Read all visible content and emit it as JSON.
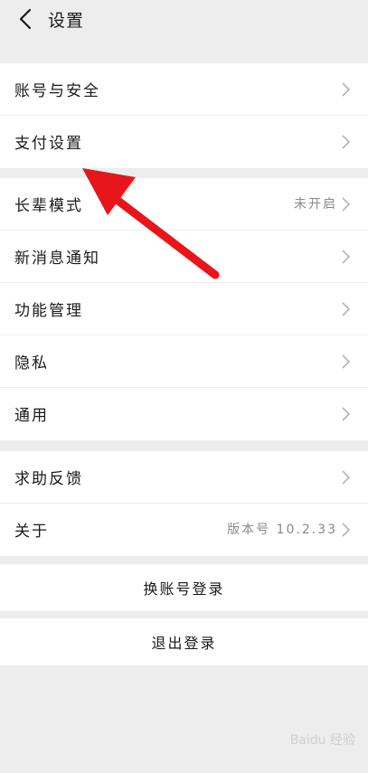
{
  "header": {
    "title": "设置"
  },
  "groups": [
    {
      "items": [
        {
          "label": "账号与安全",
          "value": ""
        },
        {
          "label": "支付设置",
          "value": ""
        }
      ]
    },
    {
      "items": [
        {
          "label": "长辈模式",
          "value": "未开启"
        },
        {
          "label": "新消息通知",
          "value": ""
        },
        {
          "label": "功能管理",
          "value": ""
        },
        {
          "label": "隐私",
          "value": ""
        },
        {
          "label": "通用",
          "value": ""
        }
      ]
    },
    {
      "items": [
        {
          "label": "求助反馈",
          "value": ""
        },
        {
          "label": "关于",
          "value": "版本号 10.2.33"
        }
      ]
    }
  ],
  "actions": {
    "switch_account": "换账号登录",
    "logout": "退出登录"
  },
  "watermark": {
    "text": "Baidu 经验"
  },
  "colors": {
    "page_bg": "#ededed",
    "row_bg": "#ffffff",
    "annotation_arrow": "#e8151b",
    "secondary_text": "#8a8a8a"
  },
  "icons": {
    "back": "back-arrow-icon",
    "row_indicator": "chevron-right-icon"
  }
}
